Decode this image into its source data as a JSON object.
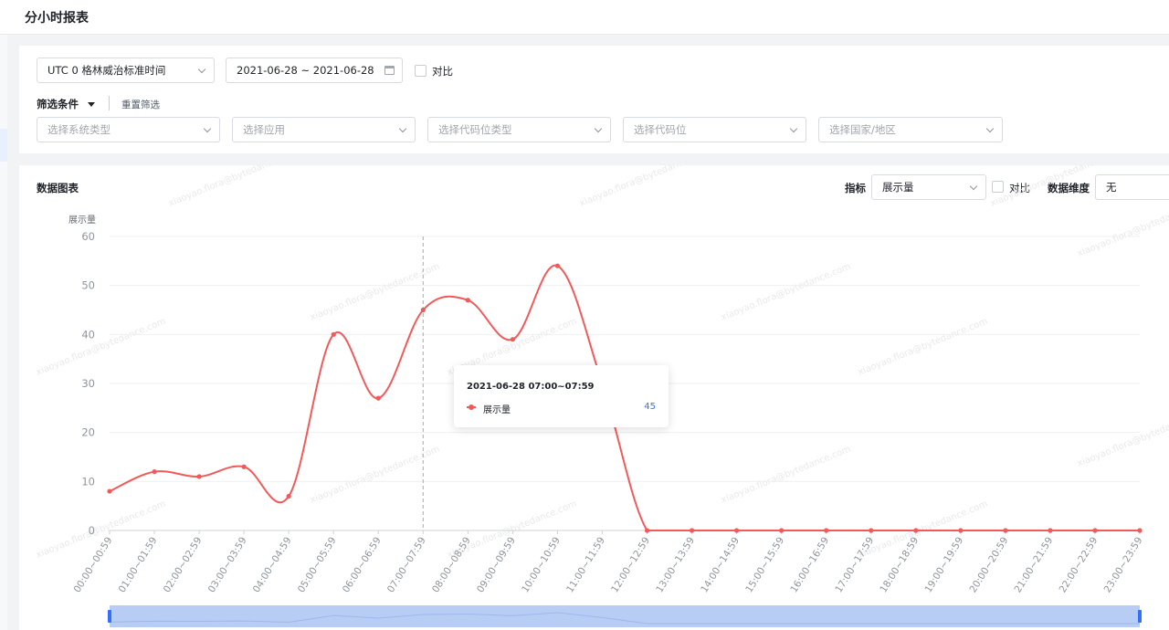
{
  "page": {
    "title": "分小时报表"
  },
  "filters": {
    "timezone": "UTC 0 格林威治标准时间",
    "date_range": "2021-06-28 ~ 2021-06-28",
    "compare_label": "对比",
    "filter_label": "筛选条件",
    "reset_label": "重置筛选",
    "selects": [
      {
        "placeholder": "选择系统类型"
      },
      {
        "placeholder": "选择应用"
      },
      {
        "placeholder": "选择代码位类型"
      },
      {
        "placeholder": "选择代码位"
      },
      {
        "placeholder": "选择国家/地区"
      }
    ]
  },
  "chart_panel": {
    "title": "数据图表",
    "metric_label": "指标",
    "metric_value": "展示量",
    "compare_label": "对比",
    "dimension_label": "数据维度",
    "dimension_value": "无"
  },
  "tooltip": {
    "title": "2021-06-28 07:00~07:59",
    "series_name": "展示量",
    "value": "45"
  },
  "watermark": "xiaoyao.flora@bytedance.com",
  "chart_data": {
    "type": "line",
    "ylabel": "展示量",
    "ylim": [
      0,
      60
    ],
    "yticks": [
      0,
      10,
      20,
      30,
      40,
      50,
      60
    ],
    "smooth": true,
    "grid": true,
    "color": "#f25a5a",
    "categories": [
      "00:00~00:59",
      "01:00~01:59",
      "02:00~02:59",
      "03:00~03:59",
      "04:00~04:59",
      "05:00~05:59",
      "06:00~06:59",
      "07:00~07:59",
      "08:00~08:59",
      "09:00~09:59",
      "10:00~10:59",
      "11:00~11:59",
      "12:00~12:59",
      "13:00~13:59",
      "14:00~14:59",
      "15:00~15:59",
      "16:00~16:59",
      "17:00~17:59",
      "18:00~18:59",
      "19:00~19:59",
      "20:00~20:59",
      "21:00~21:59",
      "22:00~22:59",
      "23:00~23:59"
    ],
    "series": [
      {
        "name": "展示量",
        "values": [
          8,
          12,
          11,
          13,
          7,
          40,
          27,
          45,
          47,
          39,
          54,
          30,
          0,
          0,
          0,
          0,
          0,
          0,
          0,
          0,
          0,
          0,
          0,
          0
        ]
      }
    ],
    "highlight_index": 7
  }
}
